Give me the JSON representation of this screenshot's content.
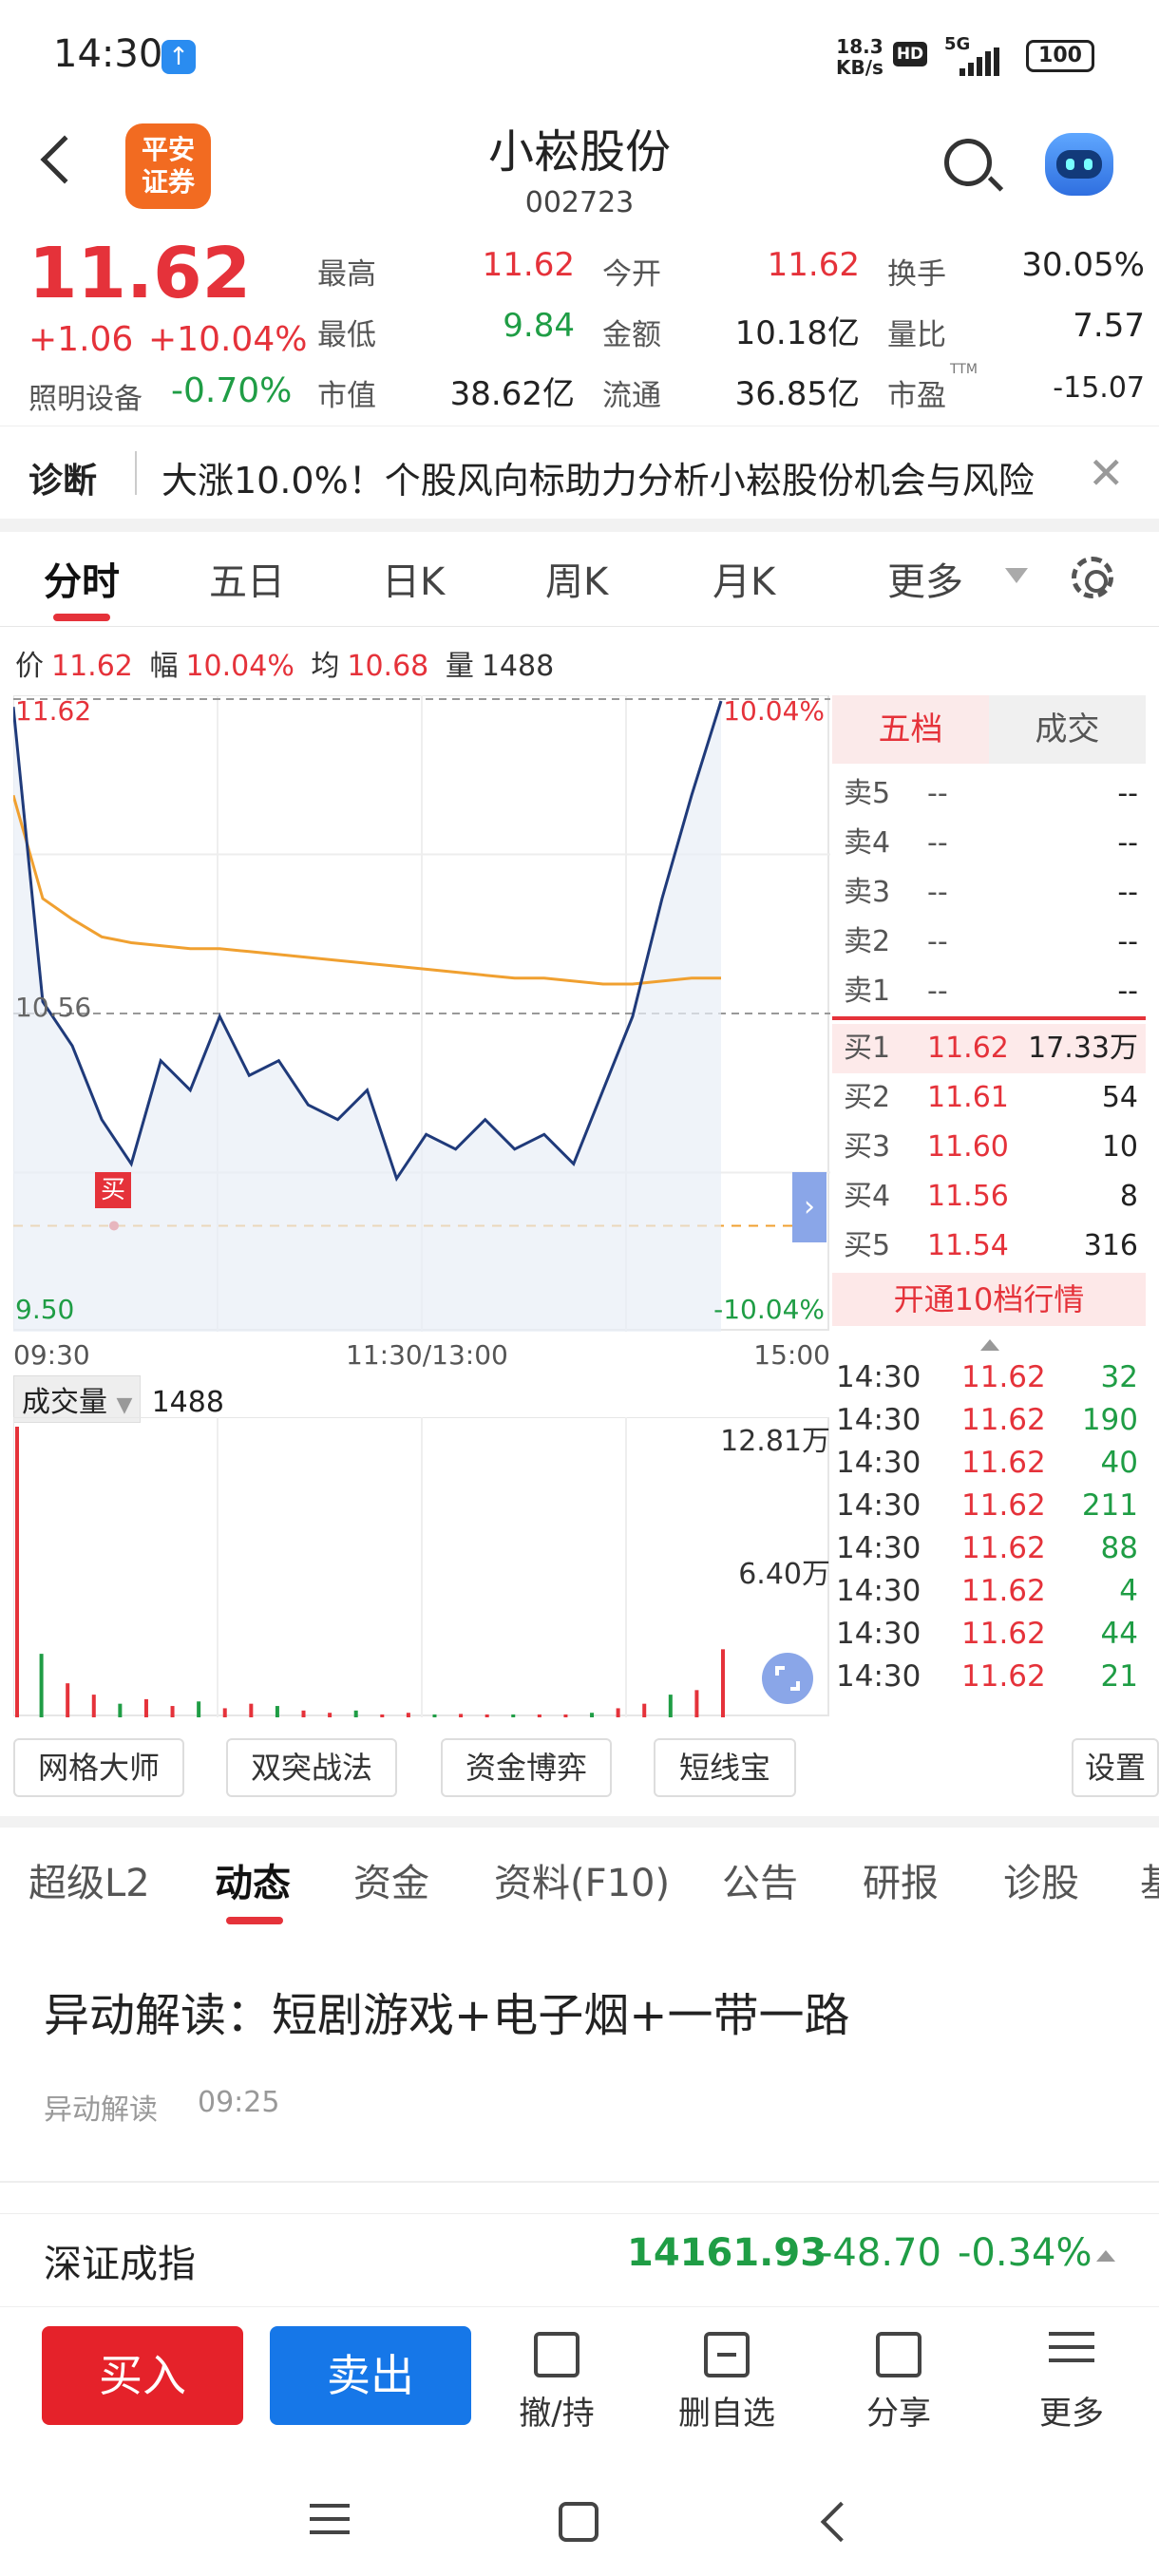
{
  "status_bar": {
    "time": "14:30",
    "net_speed": "18.3",
    "net_unit": "KB/s",
    "hd": "HD",
    "signal": "5G",
    "battery": "100"
  },
  "header": {
    "logo_line1": "平安",
    "logo_line2": "证券",
    "stock_name": "小崧股份",
    "stock_code": "002723"
  },
  "quote": {
    "price": "11.62",
    "change": "+1.06",
    "change_pct": "+10.04%",
    "sector_name": "照明设备",
    "sector_change": "-0.70%",
    "fields": [
      {
        "label": "最高",
        "value": "11.62",
        "color": "#e5323a"
      },
      {
        "label": "今开",
        "value": "11.62",
        "color": "#e5323a"
      },
      {
        "label": "换手",
        "value": "30.05%",
        "color": "#222222"
      },
      {
        "label": "最低",
        "value": "9.84",
        "color": "#1f9d45"
      },
      {
        "label": "金额",
        "value": "10.18亿",
        "color": "#222222"
      },
      {
        "label": "量比",
        "value": "7.57",
        "color": "#222222"
      },
      {
        "label": "市值",
        "value": "38.62亿",
        "color": "#222222"
      },
      {
        "label": "流通",
        "value": "36.85亿",
        "color": "#222222"
      },
      {
        "label": "市盈",
        "value": "-15.07",
        "color": "#222222"
      }
    ],
    "ttm": "TTM"
  },
  "diagnosis": {
    "label": "诊断",
    "text": "大涨10.0%！个股风向标助力分析小崧股份机会与风险"
  },
  "chart_tabs": [
    "分时",
    "五日",
    "日K",
    "周K",
    "月K",
    "更多"
  ],
  "info_line": {
    "price_label": "价",
    "price": "11.62",
    "amp_label": "幅",
    "amp": "10.04%",
    "avg_label": "均",
    "avg": "10.68",
    "vol_label": "量",
    "vol": "1488"
  },
  "chart_labels": {
    "top_price": "11.62",
    "top_pct": "10.04%",
    "mid_price": "10.56",
    "bottom_price": "9.50",
    "bottom_pct": "-10.04%",
    "buy_marker": "买",
    "time_start": "09:30",
    "time_mid": "11:30/13:00",
    "time_end": "15:00"
  },
  "chart_data": {
    "type": "line",
    "title": "",
    "xlabel": "",
    "ylabel": "",
    "x": [
      "09:30",
      "11:30/13:00",
      "15:00"
    ],
    "ylim": [
      9.5,
      11.62
    ],
    "series": [
      {
        "name": "价",
        "values": [
          11.6,
          10.6,
          10.45,
          10.2,
          10.05,
          10.4,
          10.3,
          10.55,
          10.35,
          10.4,
          10.25,
          10.2,
          10.3,
          10.0,
          10.15,
          10.1,
          10.2,
          10.1,
          10.15,
          10.05,
          10.3,
          10.55,
          10.95,
          11.3,
          11.62
        ]
      },
      {
        "name": "均",
        "values": [
          11.3,
          10.95,
          10.88,
          10.82,
          10.8,
          10.79,
          10.78,
          10.78,
          10.77,
          10.76,
          10.75,
          10.74,
          10.73,
          10.72,
          10.71,
          10.7,
          10.69,
          10.68,
          10.68,
          10.67,
          10.66,
          10.66,
          10.67,
          10.68,
          10.68
        ]
      }
    ],
    "volume_ticks": [
      "12.81万",
      "6.40万"
    ],
    "volume_values": [
      12.81,
      2.8,
      1.5,
      1.0,
      0.6,
      0.8,
      0.5,
      0.7,
      0.4,
      0.6,
      0.5,
      0.3,
      0.2,
      0.3,
      0.1,
      0.2,
      0.1,
      0.15,
      0.1,
      0.1,
      0.12,
      0.1,
      0.2,
      0.4,
      0.6,
      1.0,
      1.2,
      3.0
    ]
  },
  "volume_header": {
    "label": "成交量",
    "value": "1488"
  },
  "order_book": {
    "tabs": [
      "五档",
      "成交"
    ],
    "sells": [
      {
        "level": "卖5",
        "price": "--",
        "vol": "--"
      },
      {
        "level": "卖4",
        "price": "--",
        "vol": "--"
      },
      {
        "level": "卖3",
        "price": "--",
        "vol": "--"
      },
      {
        "level": "卖2",
        "price": "--",
        "vol": "--"
      },
      {
        "level": "卖1",
        "price": "--",
        "vol": "--"
      }
    ],
    "buys": [
      {
        "level": "买1",
        "price": "11.62",
        "vol": "17.33万"
      },
      {
        "level": "买2",
        "price": "11.61",
        "vol": "54"
      },
      {
        "level": "买3",
        "price": "11.60",
        "vol": "10"
      },
      {
        "level": "买4",
        "price": "11.56",
        "vol": "8"
      },
      {
        "level": "买5",
        "price": "11.54",
        "vol": "316"
      }
    ],
    "open10": "开通10档行情"
  },
  "ticks": [
    {
      "time": "14:30",
      "price": "11.62",
      "vol": "32"
    },
    {
      "time": "14:30",
      "price": "11.62",
      "vol": "190"
    },
    {
      "time": "14:30",
      "price": "11.62",
      "vol": "40"
    },
    {
      "time": "14:30",
      "price": "11.62",
      "vol": "211"
    },
    {
      "time": "14:30",
      "price": "11.62",
      "vol": "88"
    },
    {
      "time": "14:30",
      "price": "11.62",
      "vol": "4"
    },
    {
      "time": "14:30",
      "price": "11.62",
      "vol": "44"
    },
    {
      "time": "14:30",
      "price": "11.62",
      "vol": "21"
    }
  ],
  "tool_chips": [
    "网格大师",
    "双突战法",
    "资金博弈",
    "短线宝",
    "设置"
  ],
  "content_tabs": [
    "超级L2",
    "动态",
    "资金",
    "资料(F10)",
    "公告",
    "研报",
    "诊股",
    "基"
  ],
  "news": {
    "title": "异动解读：短剧游戏+电子烟+一带一路",
    "source": "异动解读",
    "time": "09:25"
  },
  "index_bar": {
    "name": "深证成指",
    "value": "14161.93",
    "change": "-48.70",
    "change_pct": "-0.34%"
  },
  "actions": {
    "buy": "买入",
    "sell": "卖出",
    "items": [
      "撤/持",
      "删自选",
      "分享",
      "更多"
    ]
  },
  "colors": {
    "up": "#e5323a",
    "down": "#1f9d45",
    "buy_button": "#e5222a",
    "sell_button": "#1677e8",
    "avg_line": "#f0a030",
    "price_line": "#1f3a7a"
  }
}
